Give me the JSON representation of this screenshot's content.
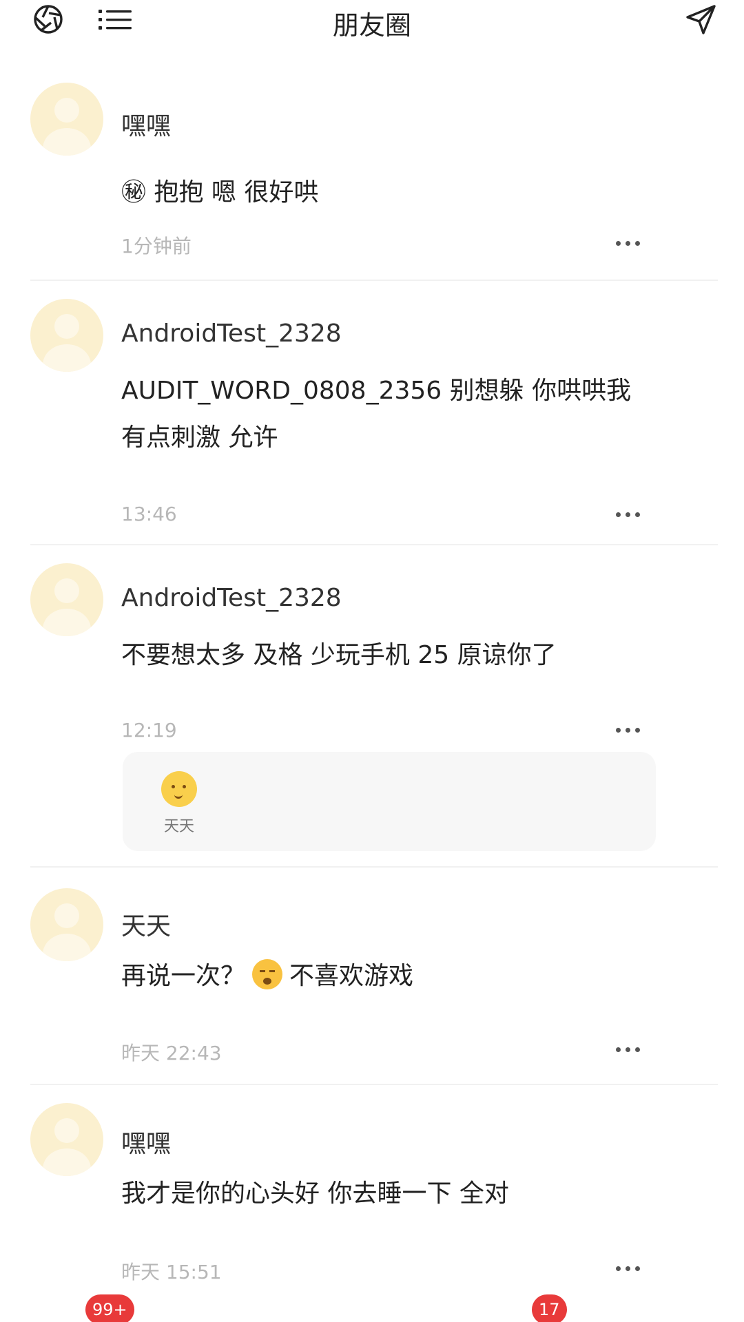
{
  "header": {
    "title": "朋友圈",
    "left_icons": [
      "camera-shutter-icon",
      "menu-list-icon"
    ],
    "right_icon": "send-icon"
  },
  "posts": [
    {
      "name": "嘿嘿",
      "content": "㊙ 抱抱 嗯 很好哄",
      "time": "1分钟前"
    },
    {
      "name": "AndroidTest_2328",
      "content_lines": [
        "AUDIT_WORD_0808_2356 别想躲 你哄哄我",
        "有点刺激 允许"
      ],
      "time": "13:46"
    },
    {
      "name": "AndroidTest_2328",
      "content": "不要想太多 及格 少玩手机 25 原谅你了",
      "time": "12:19",
      "likes": [
        "天天"
      ]
    },
    {
      "name": "天天",
      "content_before": "再说一次？",
      "emoji": "yawning-face-emoji",
      "content_after": "不喜欢游戏",
      "time": "昨天 22:43"
    },
    {
      "name": "嘿嘿",
      "content": "我才是你的心头好 你去睡一下 全对",
      "time": "昨天 15:51"
    }
  ],
  "bottom_nav": {
    "badges": [
      "99+",
      "17"
    ]
  }
}
